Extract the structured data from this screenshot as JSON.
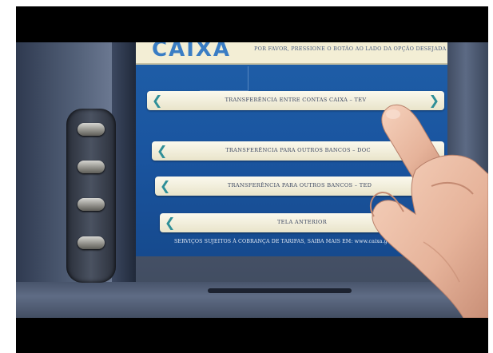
{
  "screen": {
    "logo": "CAIXA",
    "instruction": "POR FAVOR, PRESSIONE O BOTÃO AO LADO DA OPÇÃO DESEJADA",
    "options": [
      {
        "label": "TRANSFERÊNCIA ENTRE CONTAS CAIXA – TEV"
      },
      {
        "label": "TRANSFERÊNCIA PARA OUTROS BANCOS – DOC"
      },
      {
        "label": "TRANSFERÊNCIA PARA OUTROS BANCOS – TED"
      },
      {
        "label": "TELA ANTERIOR"
      }
    ],
    "footer": "SERVIÇOS SUJEITOS À COBRANÇA DE TARIFAS, SAIBA MAIS EM: www.caixa.gov.b",
    "chevron_left": "❮",
    "chevron_right": "❯"
  },
  "colors": {
    "screen_blue": "#1a55a0",
    "option_bg": "#f3efda",
    "chevron": "#2f8f98",
    "logo": "#3a7dc4"
  }
}
